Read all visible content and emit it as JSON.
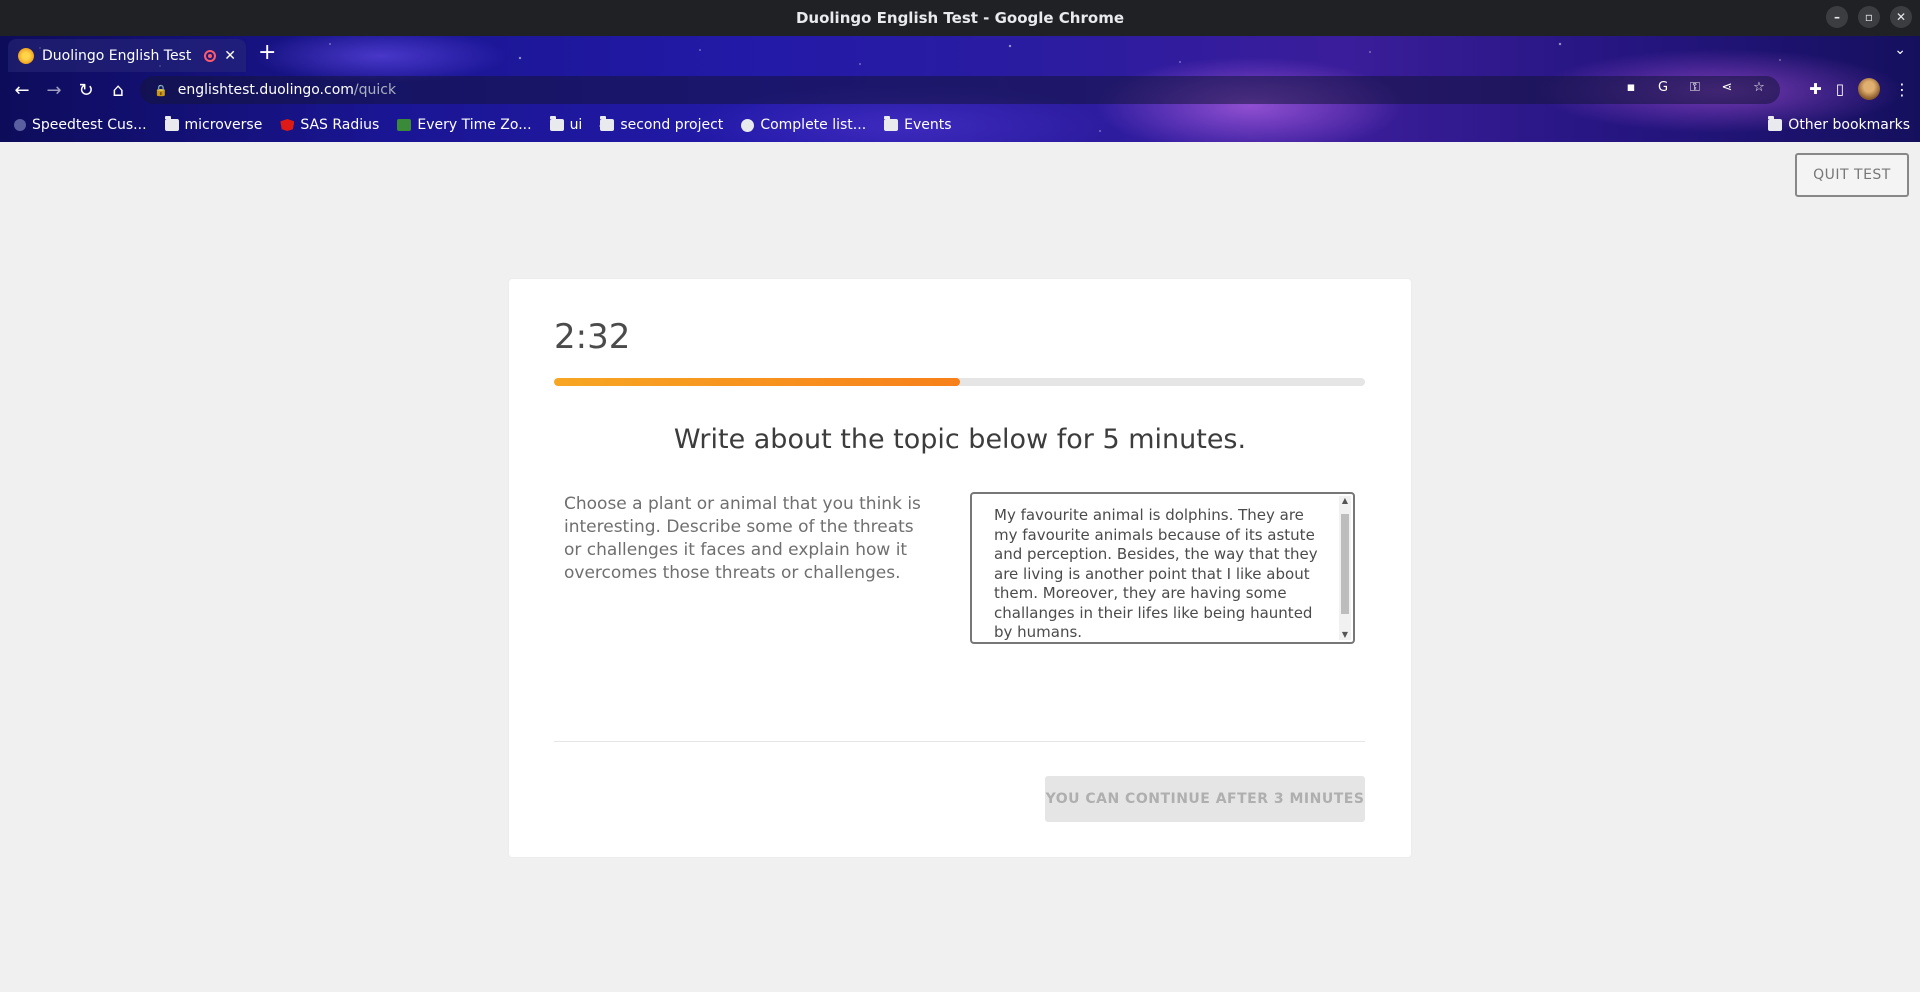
{
  "window": {
    "title": "Duolingo English Test - Google Chrome",
    "controls": [
      "–",
      "▫",
      "✕"
    ]
  },
  "tab": {
    "title": "Duolingo English Test"
  },
  "omnibox": {
    "host": "englishtest.duolingo.com",
    "path": "/quick"
  },
  "bookmarks": {
    "items": [
      {
        "label": "Speedtest Cus...",
        "icon": "globe-icon"
      },
      {
        "label": "microverse",
        "icon": "folder-icon"
      },
      {
        "label": "SAS Radius",
        "icon": "angular-icon"
      },
      {
        "label": "Every Time Zo...",
        "icon": "clock-icon"
      },
      {
        "label": "ui",
        "icon": "folder-icon"
      },
      {
        "label": "second project",
        "icon": "folder-icon"
      },
      {
        "label": "Complete list...",
        "icon": "github-icon"
      },
      {
        "label": "Events",
        "icon": "folder-icon"
      }
    ],
    "other": "Other bookmarks"
  },
  "page": {
    "quit_label": "QUIT TEST",
    "timer": "2:32",
    "progress_fraction": 0.5,
    "heading": "Write about the topic below for 5 minutes.",
    "prompt": "Choose a plant or animal that you think is interesting. Describe some of the threats or challenges it faces and explain how it overcomes those threats or challenges.",
    "answer": "My favourite animal is dolphins. They are my favourite animals because of its astute and perception. Besides, the way that they are living is another point that I like about them. Moreover, they are having some challanges in their lifes like being haunted by humans.",
    "continue_label": "YOU CAN CONTINUE AFTER 3 MINUTES"
  },
  "colors": {
    "progress_start": "#f7a623",
    "progress_end": "#f7801a",
    "page_bg": "#f0f0f0",
    "card_bg": "#ffffff"
  }
}
